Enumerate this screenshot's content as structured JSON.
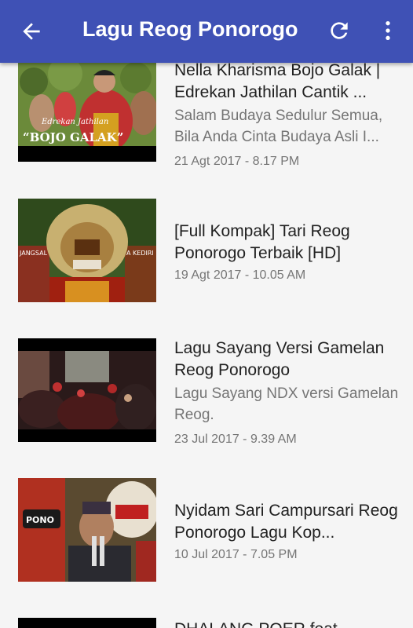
{
  "appbar": {
    "title": "Lagu Reog Ponorogo",
    "back_icon": "arrow-back-icon",
    "refresh_icon": "refresh-icon",
    "menu_icon": "more-vert-icon",
    "color": "#3f51b5"
  },
  "videos": [
    {
      "title": "Nella Kharisma Bojo Galak | Edrekan Jathilan Cantik ...",
      "description": "Salam Budaya Sedulur Semua, Bila Anda Cinta Budaya Asli I...",
      "date": "21 Agt 2017 - 8.17 PM",
      "thumb_caption_small": "Edrekan Jathilan",
      "thumb_caption_big": "“BOJO GALAK”"
    },
    {
      "title": "[Full Kompak] Tari Reog Ponorogo Terbaik [HD]",
      "description": "",
      "date": "19 Agt 2017 - 10.05 AM",
      "thumb_text_left": "JANGSAL",
      "thumb_text_right": "A KEDIRI"
    },
    {
      "title": "Lagu Sayang Versi Gamelan Reog Ponorogo",
      "description": "Lagu Sayang NDX versi Gamelan Reog.",
      "date": "23 Jul 2017 - 9.39 AM"
    },
    {
      "title": "Nyidam Sari Campursari Reog Ponorogo Lagu Kop...",
      "description": "",
      "date": "10 Jul 2017 - 7.05 PM",
      "thumb_text": "PONO"
    },
    {
      "title": "DHALANG POER feat",
      "description": "",
      "date": ""
    }
  ]
}
